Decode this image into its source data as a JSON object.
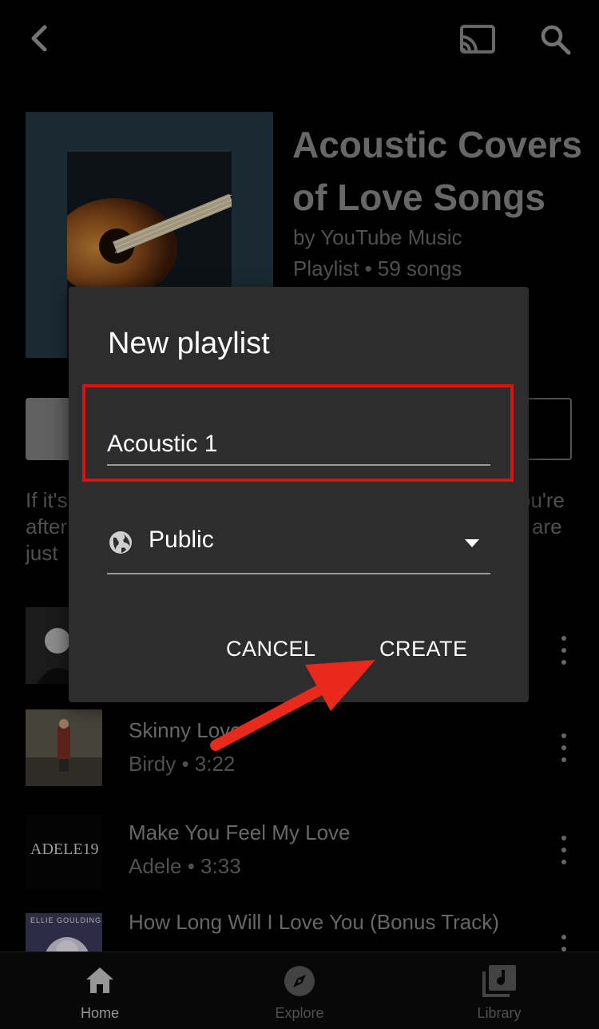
{
  "playlist": {
    "title": "Acoustic Covers of Love Songs",
    "author": "by YouTube Music",
    "meta": "Playlist • 59 songs",
    "description_fragments": [
      "If it's",
      "after",
      "just",
      "ou're",
      "are"
    ]
  },
  "songs": [
    {
      "title": "Skinny Love",
      "subtitle": "Birdy • 3:22"
    },
    {
      "title": "Make You Feel My Love",
      "subtitle": "Adele • 3:33",
      "thumb_text": "ADELE19"
    },
    {
      "title": "How Long Will I Love You (Bonus Track)",
      "subtitle": "",
      "thumb_text": "ELLIE GOULDING"
    }
  ],
  "dialog": {
    "title": "New playlist",
    "name_value": "Acoustic 1",
    "privacy_value": "Public",
    "cancel_label": "CANCEL",
    "create_label": "CREATE"
  },
  "nav": [
    {
      "label": "Home",
      "icon": "home-icon",
      "active": true
    },
    {
      "label": "Explore",
      "icon": "compass-icon",
      "active": false
    },
    {
      "label": "Library",
      "icon": "library-icon",
      "active": false
    }
  ],
  "colors": {
    "highlight": "#e01010",
    "arrow": "#e8291c",
    "dialog_bg": "#2d2d2d"
  }
}
